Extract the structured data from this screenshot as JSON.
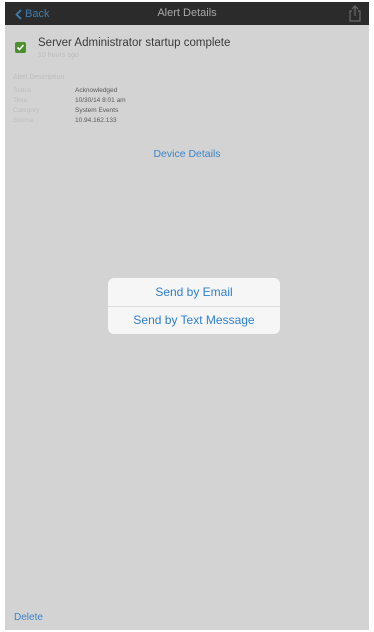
{
  "nav": {
    "back_label": "Back",
    "title": "Alert Details"
  },
  "alert": {
    "title": "Server Administrator startup complete",
    "time": "10 hours ago",
    "status_color": "#4c8f2f"
  },
  "details": {
    "section_label": "Alert Description",
    "rows": [
      {
        "key": "Status",
        "value": "Acknowledged"
      },
      {
        "key": "Time",
        "value": "10/30/14 8:01 am"
      },
      {
        "key": "Category",
        "value": "System Events"
      },
      {
        "key": "Source",
        "value": "10.94.162.133"
      }
    ]
  },
  "device_details_link": "Device Details",
  "action_sheet": {
    "items": [
      {
        "label": "Send by Email"
      },
      {
        "label": "Send by Text Message"
      }
    ]
  },
  "footer": {
    "delete_label": "Delete"
  }
}
